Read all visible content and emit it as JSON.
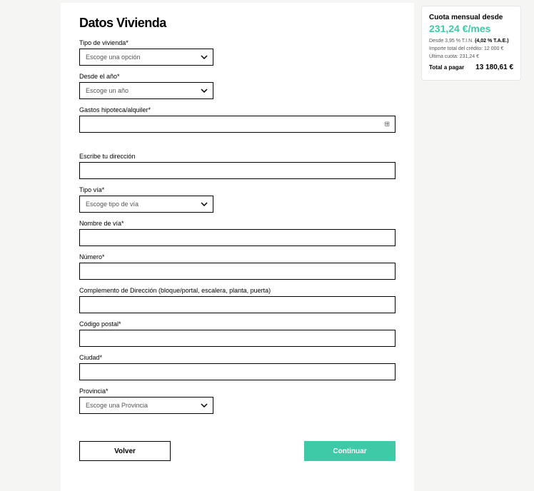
{
  "form": {
    "title": "Datos Vivienda",
    "tipo_vivienda": {
      "label": "Tipo de vivienda*",
      "placeholder": "Escoge una opción"
    },
    "desde_ano": {
      "label": "Desde el año*",
      "placeholder": "Escoge un año"
    },
    "gastos": {
      "label": "Gastos hipoteca/alquiler*"
    },
    "direccion": {
      "label": "Escribe tu dirección"
    },
    "tipo_via": {
      "label": "Tipo vía*",
      "placeholder": "Escoge tipo de vía"
    },
    "nombre_via": {
      "label": "Nombre de vía*"
    },
    "numero": {
      "label": "Número*"
    },
    "complemento": {
      "label": "Complemento de Dirección (bloque/portal, escalera, planta, puerta)"
    },
    "codigo_postal": {
      "label": "Código postal*"
    },
    "ciudad": {
      "label": "Ciudad*"
    },
    "provincia": {
      "label": "Provincia*",
      "placeholder": "Escoge una Provincia"
    },
    "back": "Volver",
    "continue": "Continuar"
  },
  "summary": {
    "title": "Cuota mensual desde",
    "price": "231,24 €/mes",
    "tin_line_prefix": "Desde 3,95 % T.I.N. ",
    "tin_line_bold": "(4,02 % T.A.E.)",
    "importe": "Importe total del crédito: 12 000 €",
    "ultima": "Última cuota: 231,24 €",
    "total_label": "Total a pagar",
    "total_value": "13 180,61 €"
  }
}
